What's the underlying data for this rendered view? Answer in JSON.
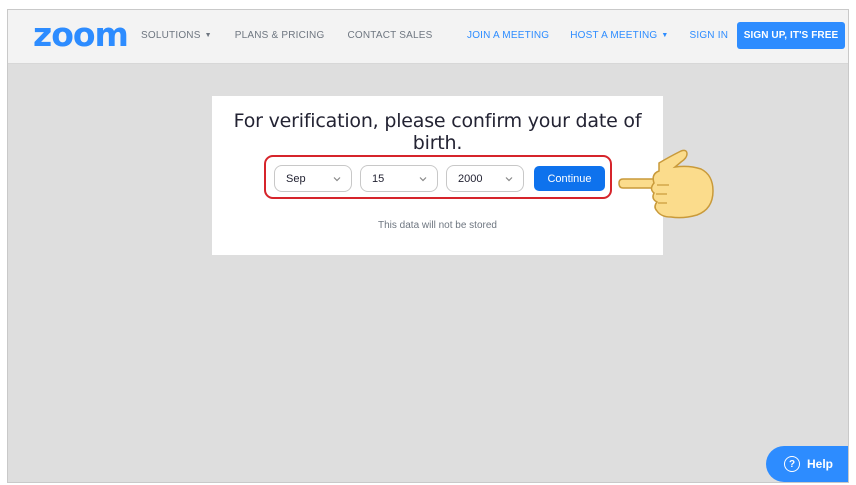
{
  "brand": {
    "logo": "zoom"
  },
  "nav": {
    "left": [
      {
        "label": "SOLUTIONS",
        "has_caret": true
      },
      {
        "label": "PLANS & PRICING"
      },
      {
        "label": "CONTACT SALES"
      }
    ],
    "right": [
      {
        "label": "JOIN A MEETING"
      },
      {
        "label": "HOST A MEETING",
        "has_caret": true
      },
      {
        "label": "SIGN IN"
      }
    ],
    "signup_label": "SIGN UP, IT'S FREE",
    "caret_glyph": "▼"
  },
  "verification": {
    "title": "For verification, please confirm your date of birth.",
    "month": "Sep",
    "day": "15",
    "year": "2000",
    "continue_label": "Continue",
    "note": "This data will not be stored"
  },
  "help": {
    "label": "Help",
    "icon_glyph": "?"
  },
  "colors": {
    "brand_blue": "#2d8cff",
    "continue_blue": "#0e72ed",
    "highlight_red": "#d6242b",
    "background_gray": "#dedede"
  },
  "icons": {
    "pointer": "pointing-hand-icon",
    "dropdown": "chevron-down-icon",
    "help": "question-circle-icon"
  }
}
